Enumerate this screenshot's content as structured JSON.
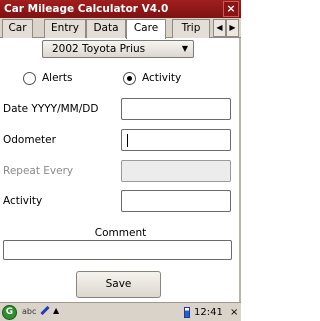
{
  "window": {
    "title": "Car Mileage Calculator V4.0",
    "close_label": "×"
  },
  "tabs": [
    {
      "label": "Car"
    },
    {
      "label": "Entry"
    },
    {
      "label": "Data"
    },
    {
      "label": "Care",
      "active": true
    },
    {
      "label": "Trip"
    }
  ],
  "tab_scroll": {
    "left": "◀",
    "right": "▶"
  },
  "vehicle_select": {
    "value": "2002 Toyota Prius",
    "arrow": "▼"
  },
  "mode": {
    "options": [
      {
        "label": "Alerts",
        "selected": false
      },
      {
        "label": "Activity",
        "selected": true
      }
    ]
  },
  "fields": {
    "date": {
      "label": "Date YYYY/MM/DD",
      "value": ""
    },
    "odometer": {
      "label": "Odometer",
      "value": ""
    },
    "repeat_every": {
      "label": "Repeat Every",
      "value": ""
    },
    "activity": {
      "label": "Activity",
      "value": ""
    }
  },
  "comment": {
    "label": "Comment",
    "value": ""
  },
  "save_label": "Save",
  "taskbar": {
    "start_glyph": "G",
    "input_label": "abc",
    "up_arrow": "▲",
    "clock": "12:41 AM",
    "close_glyph": "×"
  }
}
